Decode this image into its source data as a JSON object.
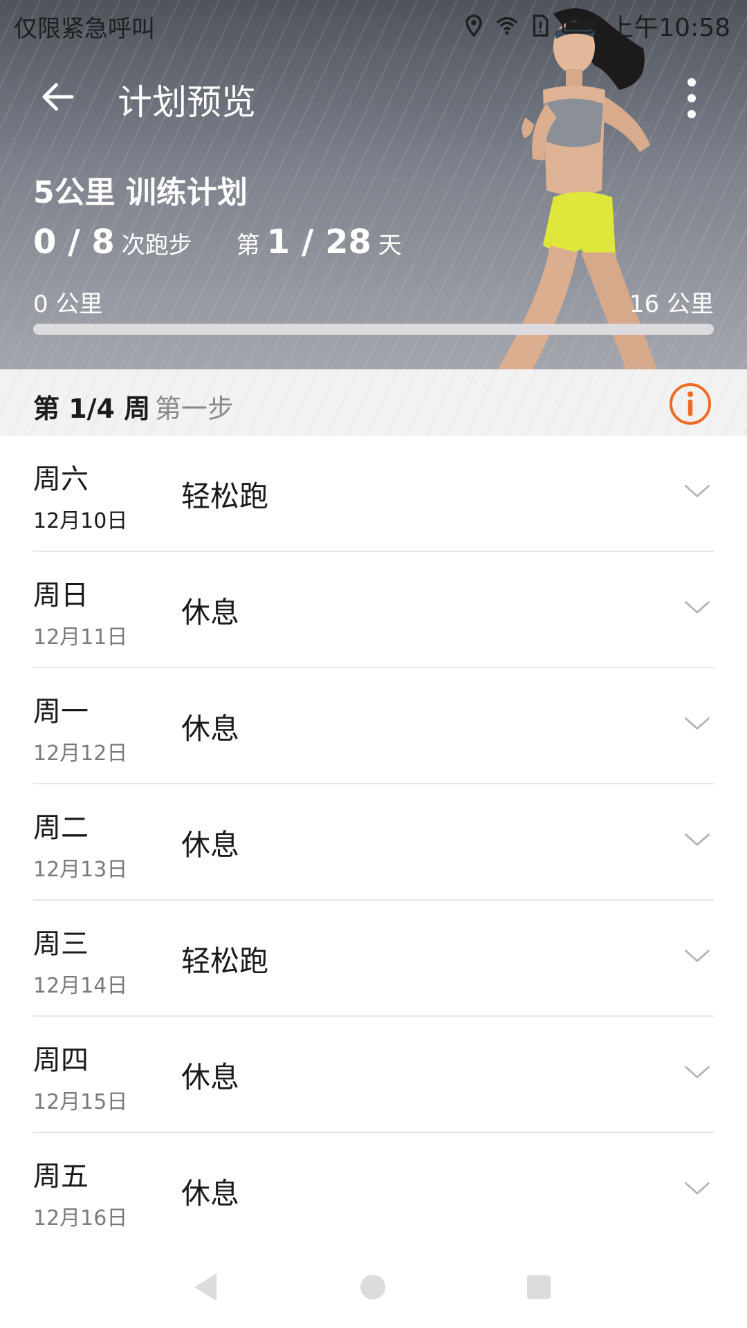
{
  "status_bar": {
    "left_text": "仅限紧急呼叫",
    "time": "上午10:58"
  },
  "toolbar": {
    "title": "计划预览"
  },
  "plan": {
    "title": "5公里 训练计划",
    "runs_done": "0 / 8",
    "runs_label": "次跑步",
    "day_prefix": "第",
    "day_value": "1 / 28",
    "day_suffix": "天",
    "km_start": "0 公里",
    "km_end": "16 公里",
    "progress_fraction": 0,
    "accent_color": "#ff6a1a"
  },
  "week": {
    "label": "第 1/4 周",
    "subtitle": "第一步",
    "info_icon_color": "#ef6a22"
  },
  "days": [
    {
      "weekday": "周六",
      "date": "12月10日",
      "activity": "轻松跑"
    },
    {
      "weekday": "周日",
      "date": "12月11日",
      "activity": "休息"
    },
    {
      "weekday": "周一",
      "date": "12月12日",
      "activity": "休息"
    },
    {
      "weekday": "周二",
      "date": "12月13日",
      "activity": "休息"
    },
    {
      "weekday": "周三",
      "date": "12月14日",
      "activity": "轻松跑"
    },
    {
      "weekday": "周四",
      "date": "12月15日",
      "activity": "休息"
    },
    {
      "weekday": "周五",
      "date": "12月16日",
      "activity": "休息"
    }
  ],
  "icons": {
    "back": "back-arrow-icon",
    "more": "more-vert-icon",
    "info": "info-icon",
    "expand": "chevron-down-icon",
    "nav_back": "nav-back-icon",
    "nav_home": "nav-home-icon",
    "nav_recents": "nav-recents-icon"
  }
}
